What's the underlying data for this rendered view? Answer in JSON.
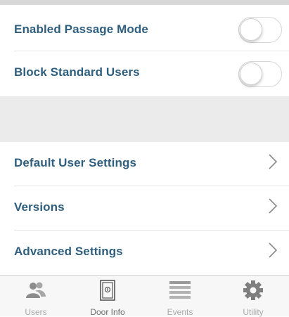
{
  "settings": {
    "passage_mode_label": "Enabled Passage Mode",
    "passage_mode_on": false,
    "block_users_label": "Block Standard Users",
    "block_users_on": false
  },
  "menu": {
    "items": [
      {
        "label": "Default User Settings",
        "icon": "chevron-right-icon"
      },
      {
        "label": "Versions",
        "icon": "chevron-right-icon"
      },
      {
        "label": "Advanced Settings",
        "icon": "chevron-right-icon"
      }
    ]
  },
  "tabbar": {
    "tabs": [
      {
        "label": "Users",
        "icon": "users-icon",
        "active": false
      },
      {
        "label": "Door Info",
        "icon": "door-icon",
        "active": true
      },
      {
        "label": "Events",
        "icon": "list-icon",
        "active": false
      },
      {
        "label": "Utility",
        "icon": "gear-icon",
        "active": false
      }
    ]
  },
  "colors": {
    "label_text": "#2f5f7e",
    "section_band": "#ebebeb",
    "tab_inactive": "#a9a9a9",
    "tab_active": "#6d6d6d"
  }
}
